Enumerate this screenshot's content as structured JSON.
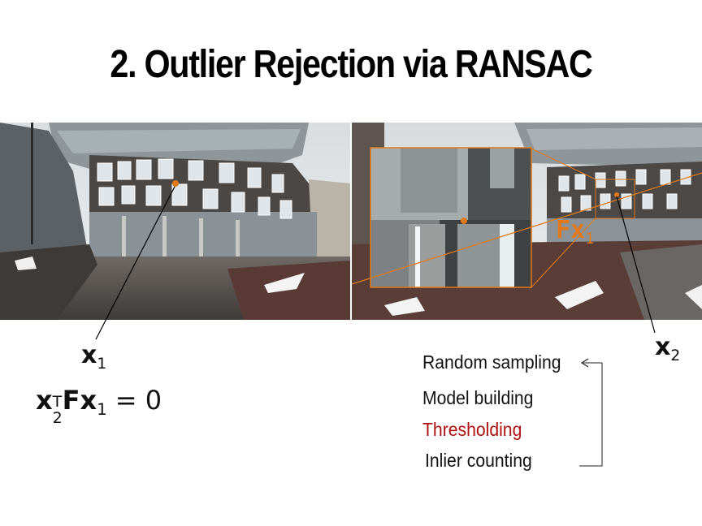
{
  "title": "2. Outlier Rejection via RANSAC",
  "labels": {
    "x1_main": "x",
    "x1_sub": "1",
    "x2_main": "x",
    "x2_sub": "2",
    "fx_main": "Fx",
    "fx_sub": "1"
  },
  "equation": {
    "x": "x",
    "x_sub": "2",
    "x_sup": "T",
    "F": "F",
    "x1": "x",
    "x1_sub": "1",
    "rhs": "= 0"
  },
  "steps": [
    {
      "label": "Random sampling",
      "color": "#111111"
    },
    {
      "label": "Model building",
      "color": "#111111"
    },
    {
      "label": "Thresholding",
      "color": "#b01010"
    },
    {
      "label": "Inlier counting",
      "color": "#111111"
    }
  ],
  "colors": {
    "epipolar_line": "#e07a1a",
    "point": "#e07a1a",
    "fx_label": "#e07a1a"
  }
}
